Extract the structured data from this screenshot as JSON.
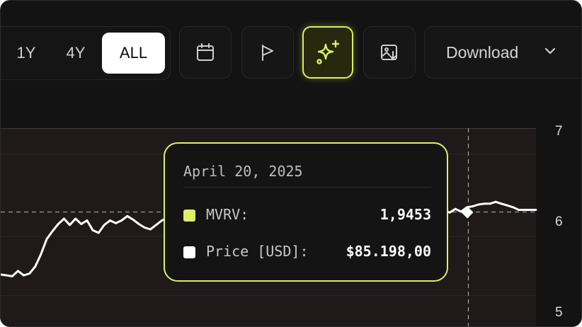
{
  "toolbar": {
    "ranges": [
      {
        "label": "1Y",
        "active": false
      },
      {
        "label": "4Y",
        "active": false
      },
      {
        "label": "ALL",
        "active": true
      }
    ],
    "icons": [
      "calendar-icon",
      "flag-icon",
      "sparkles-icon",
      "image-download-icon",
      "chevron-down-icon"
    ],
    "download_label": "Download",
    "accent_color": "#dcef66"
  },
  "chart_data": {
    "type": "line",
    "title": "",
    "xlabel": "",
    "ylabel": "",
    "y_ticks": [
      "7",
      "6",
      "5"
    ],
    "ylim": [
      5,
      7
    ],
    "reference_line_y": 6,
    "grid": true,
    "series": [
      {
        "name": "MVRV",
        "color": "#ffffff",
        "values": [
          5.29,
          5.28,
          5.27,
          5.33,
          5.28,
          5.3,
          5.38,
          5.52,
          5.69,
          5.78,
          5.86,
          5.92,
          5.85,
          5.92,
          5.86,
          5.9,
          5.79,
          5.76,
          5.85,
          5.9,
          5.87,
          5.9,
          5.95,
          5.91,
          5.86,
          5.82,
          5.8,
          5.85,
          5.9,
          5.93,
          5.95,
          5.95,
          5.96,
          5.96,
          5.97,
          5.98,
          5.98,
          5.97,
          5.98,
          6.0,
          5.99,
          6.01,
          6.0,
          5.99,
          6.01,
          6.02,
          6.04,
          6.07,
          6.06,
          6.08,
          6.07,
          6.09,
          6.1,
          6.08,
          6.07,
          6.09,
          6.07,
          6.08,
          6.07,
          6.1,
          6.05,
          6.03,
          6.06,
          6.07,
          6.05,
          6.02,
          6.04,
          6.06,
          6.03,
          6.05,
          6.02,
          6.04,
          6.05,
          6.01,
          6.04,
          6.04,
          6.05,
          6.02,
          5.99,
          6.03,
          6.0,
          6.05,
          6.06,
          6.08,
          6.09,
          6.09,
          6.11,
          6.09,
          6.07,
          6.05,
          6.02,
          6.02,
          6.02,
          6.02
        ]
      }
    ]
  },
  "tooltip": {
    "date": "April 20, 2025",
    "rows": [
      {
        "label": "MVRV:",
        "value": "1,9453",
        "color": "#dcef66"
      },
      {
        "label": "Price [USD]:",
        "value": "$85.198,00",
        "color": "#ffffff"
      }
    ]
  }
}
